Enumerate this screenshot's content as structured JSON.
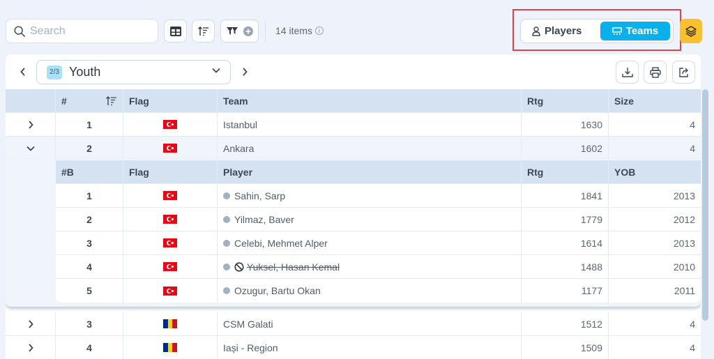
{
  "toolbar": {
    "search_placeholder": "Search",
    "items_count": "14 items",
    "view_toggle": {
      "players_label": "Players",
      "teams_label": "Teams",
      "active": "Teams"
    }
  },
  "group_nav": {
    "badge": "2/3",
    "label": "Youth"
  },
  "table": {
    "headers": {
      "num": "#",
      "flag": "Flag",
      "team": "Team",
      "rtg": "Rtg",
      "size": "Size"
    },
    "rows": [
      {
        "num": "1",
        "flag": "TR",
        "team": "Istanbul",
        "rtg": "1630",
        "size": "4",
        "expanded": false
      },
      {
        "num": "2",
        "flag": "TR",
        "team": "Ankara",
        "rtg": "1602",
        "size": "4",
        "expanded": true
      },
      {
        "num": "3",
        "flag": "RO",
        "team": "CSM Galati",
        "rtg": "1512",
        "size": "4",
        "expanded": false
      },
      {
        "num": "4",
        "flag": "RO",
        "team": "Iași - Region",
        "rtg": "1509",
        "size": "4",
        "expanded": false
      }
    ],
    "subtable": {
      "headers": {
        "board": "#B",
        "flag": "Flag",
        "player": "Player",
        "rtg": "Rtg",
        "yob": "YOB"
      },
      "rows": [
        {
          "board": "1",
          "flag": "TR",
          "player": "Sahin, Sarp",
          "rtg": "1841",
          "yob": "2013",
          "withdrawn": false
        },
        {
          "board": "2",
          "flag": "TR",
          "player": "Yilmaz, Baver",
          "rtg": "1779",
          "yob": "2012",
          "withdrawn": false
        },
        {
          "board": "3",
          "flag": "TR",
          "player": "Celebi, Mehmet Alper",
          "rtg": "1614",
          "yob": "2013",
          "withdrawn": false
        },
        {
          "board": "4",
          "flag": "TR",
          "player": "Yuksel, Hasan Kemal",
          "rtg": "1488",
          "yob": "2010",
          "withdrawn": true
        },
        {
          "board": "5",
          "flag": "TR",
          "player": "Ozugur, Bartu Okan",
          "rtg": "1177",
          "yob": "2011",
          "withdrawn": false
        }
      ]
    }
  },
  "colors": {
    "accent": "#0ab0ec",
    "layers_button": "#fbc02d",
    "header_bg": "#d4e2f2",
    "highlight_box": "#e2434b"
  }
}
